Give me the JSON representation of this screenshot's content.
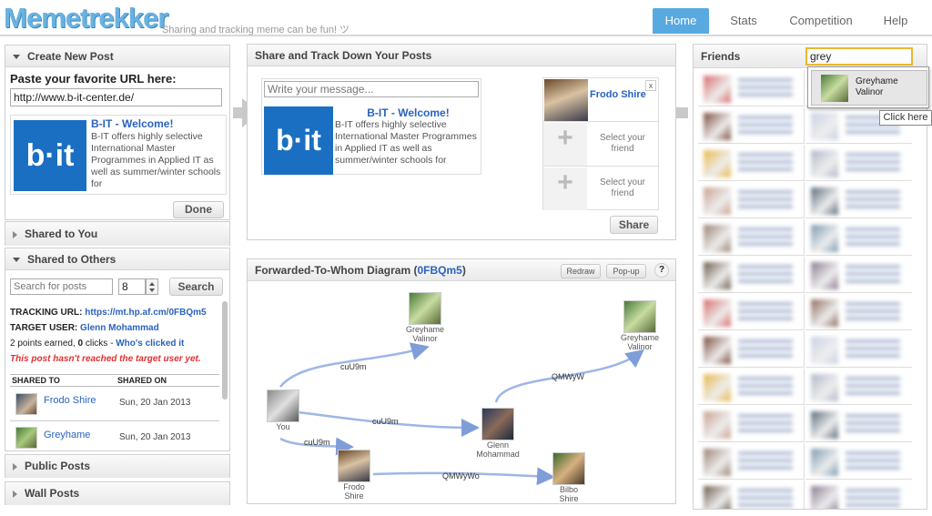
{
  "header": {
    "logo": "Memetrekker",
    "tagline": "Sharing and tracking meme can be fun! ツ",
    "nav": [
      "Home",
      "Stats",
      "Competition",
      "Help"
    ]
  },
  "create": {
    "title": "Create New Post",
    "url_label": "Paste your favorite URL here:",
    "url_value": "http://www.b-it-center.de/",
    "preview_title": "B-IT - Welcome!",
    "preview_desc": "B-IT offers highly selective International Master Programmes in Applied IT as well as summer/winter schools for",
    "logo_text": "b·it",
    "done": "Done"
  },
  "shared_you": {
    "title": "Shared to You"
  },
  "shared_others": {
    "title": "Shared to Others",
    "search_placeholder": "Search for posts",
    "count": "8",
    "search_btn": "Search",
    "tracking_label": "TRACKING URL:",
    "tracking_url": "https://mt.hp.af.cm/0FBQm5",
    "target_label": "TARGET USER:",
    "target_user": "Glenn Mohammad",
    "points": "2",
    "points_text": "points earned,",
    "clicks": "0",
    "clicks_text": "clicks -",
    "who_clicked": "Who's clicked it",
    "warning": "This post hasn't reached the target user yet.",
    "col_to": "SHARED TO",
    "col_on": "SHARED ON",
    "rows": [
      {
        "name": "Frodo Shire",
        "date": "Sun, 20 Jan 2013"
      },
      {
        "name": "Greyhame",
        "date": "Sun, 20 Jan 2013"
      }
    ]
  },
  "public": {
    "title": "Public Posts"
  },
  "wall": {
    "title": "Wall Posts"
  },
  "share": {
    "title": "Share and Track Down Your Posts",
    "msg_placeholder": "Write your message...",
    "preview_title": "B-IT - Welcome!",
    "preview_desc": "B-IT offers highly selective International Master Programmes in Applied IT as well as summer/winter schools for",
    "logo_text": "b·it",
    "friend1": "Frodo Shire",
    "select1": "Select your friend",
    "select2": "Select your friend",
    "close": "x",
    "share_btn": "Share"
  },
  "diagram": {
    "title": "Forwarded-To-Whom Diagram (",
    "code": "0FBQm5",
    "title_end": ")",
    "redraw": "Redraw",
    "popup": "Pop-up",
    "help": "?",
    "nodes": {
      "you": "You",
      "greyhame1": "Greyhame Valinor",
      "greyhame2": "Greyhame Valinor",
      "glenn": "Glenn Mohammad",
      "frodo": "Frodo Shire",
      "bilbo": "Bilbo Shire"
    },
    "edges": {
      "e1": "cuU9m",
      "e2": "cuU9m",
      "e3": "cuU9m",
      "e4": "QMWyW",
      "e5": "QMWyWo"
    }
  },
  "friends": {
    "title": "Friends",
    "search_value": "grey",
    "suggest_name": "Greyhame Valinor",
    "tooltip": "Click here",
    "colors": [
      "#d86a6a",
      "#8a6a5a",
      "#7a4a3a",
      "#c9d2e6",
      "#e8b84a",
      "#b0b8c8",
      "#c9a090",
      "#5a6a7a",
      "#9a8070",
      "#7a9ab0",
      "#6a5a4a",
      "#8a7a90"
    ]
  }
}
